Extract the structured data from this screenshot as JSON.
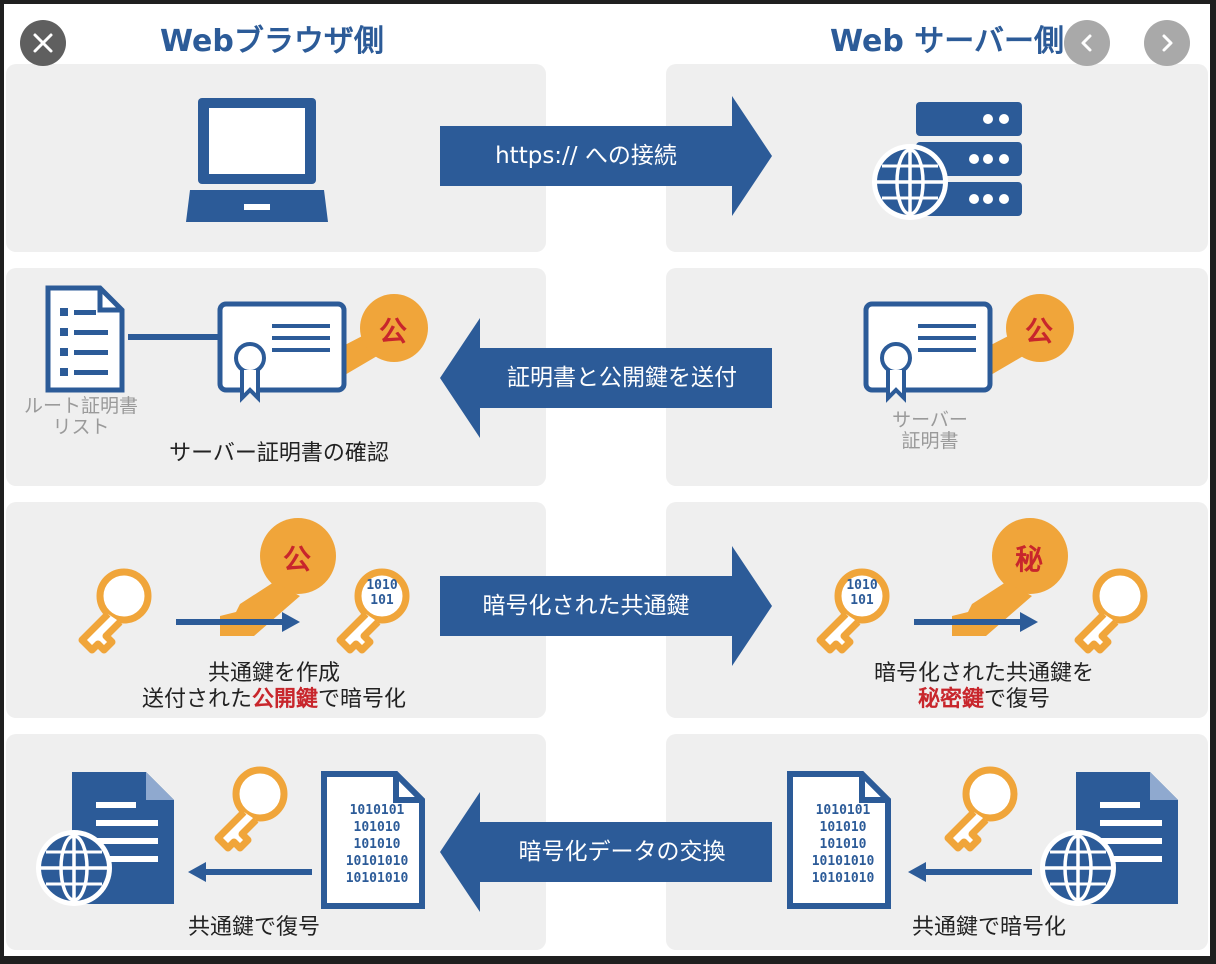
{
  "viewer": {
    "close_icon": "close-icon",
    "prev_icon": "chevron-left-icon",
    "next_icon": "chevron-right-icon"
  },
  "headers": {
    "browser": "Webブラウザ側",
    "server": "Web サーバー側"
  },
  "rows": [
    {
      "arrow_label": "https:// への接続",
      "arrow_direction": "right",
      "browser_icons": [
        "laptop-icon"
      ],
      "server_icons": [
        "server-globe-icon"
      ]
    },
    {
      "arrow_label": "証明書と公開鍵を送付",
      "arrow_direction": "left",
      "browser_caption": "サーバー証明書の確認",
      "root_list_label_1": "ルート証明書",
      "root_list_label_2": "リスト",
      "server_cert_label_1": "サーバー",
      "server_cert_label_2": "証明書",
      "public_key_badge": "公",
      "browser_icons": [
        "document-list-icon",
        "certificate-icon",
        "public-key-icon"
      ],
      "server_icons": [
        "certificate-icon",
        "public-key-icon"
      ]
    },
    {
      "arrow_label": "暗号化された共通鍵",
      "arrow_direction": "right",
      "browser_caption_1": "共通鍵を作成",
      "browser_caption_2_pre": "送付された",
      "browser_caption_2_red": "公開鍵",
      "browser_caption_2_post": "で暗号化",
      "server_caption_1": "暗号化された共通鍵を",
      "server_caption_2_red": "秘密鍵",
      "server_caption_2_post": "で復号",
      "public_key_badge": "公",
      "secret_key_badge": "秘",
      "binary_small_1": "1010",
      "binary_small_2": "101",
      "browser_icons": [
        "key-icon",
        "public-key-icon",
        "encrypted-key-icon"
      ],
      "server_icons": [
        "encrypted-key-icon",
        "secret-key-icon",
        "key-icon"
      ]
    },
    {
      "arrow_label": "暗号化データの交換",
      "arrow_direction": "left",
      "browser_caption": "共通鍵で復号",
      "server_caption": "共通鍵で暗号化",
      "binary_lines": [
        "1010101",
        "101010",
        "101010",
        "10101010",
        "10101010"
      ],
      "browser_icons": [
        "globe-document-icon",
        "key-icon",
        "binary-document-icon"
      ],
      "server_icons": [
        "binary-document-icon",
        "key-icon",
        "globe-document-icon"
      ]
    }
  ],
  "colors": {
    "navy": "#2c5b98",
    "orange": "#f0a53a",
    "red": "#c8262c",
    "panel": "#efefef",
    "gray_text": "#9a9a9a"
  }
}
